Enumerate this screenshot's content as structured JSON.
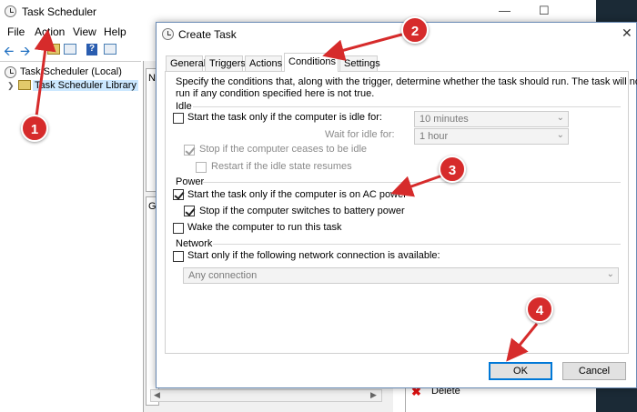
{
  "bg_window": {
    "title": "Task Scheduler",
    "menu": [
      "File",
      "Action",
      "View",
      "Help"
    ],
    "tree": [
      "Task Scheduler (Local)",
      "Task Scheduler Library"
    ],
    "mid_col_label": "N",
    "mid_col_label2": "G",
    "actions": [
      "Delete"
    ]
  },
  "dialog": {
    "title": "Create Task",
    "tabs": [
      "General",
      "Triggers",
      "Actions",
      "Conditions",
      "Settings"
    ],
    "active_tab": "Conditions",
    "description_line1": "Specify the conditions that, along with the trigger, determine whether the task should run.  The task will not",
    "description_line2": "run  if any condition specified here is not true.",
    "idle": {
      "group_label": "Idle",
      "start_if_idle": {
        "label": "Start the task only if the computer is idle for:",
        "checked": false
      },
      "idle_for_value": "10 minutes",
      "wait_label": "Wait for idle for:",
      "wait_value": "1 hour",
      "stop_if_ceases": {
        "label": "Stop if the computer ceases to be idle",
        "checked": true
      },
      "restart_if_resumes": {
        "label": "Restart if the idle state resumes",
        "checked": false
      }
    },
    "power": {
      "group_label": "Power",
      "ac_power": {
        "label": "Start the task only if the computer is on AC power",
        "checked": true
      },
      "battery": {
        "label": "Stop if the computer switches to battery power",
        "checked": true
      },
      "wake": {
        "label": "Wake the computer to run this task",
        "checked": false
      }
    },
    "network": {
      "group_label": "Network",
      "start_only_if": {
        "label": "Start only if the following network connection is available:",
        "checked": false
      },
      "connection_value": "Any connection"
    },
    "ok_label": "OK",
    "cancel_label": "Cancel"
  },
  "callouts": [
    "1",
    "2",
    "3",
    "4"
  ],
  "colors": {
    "callout": "#d62b2b",
    "accent": "#0078d7"
  }
}
